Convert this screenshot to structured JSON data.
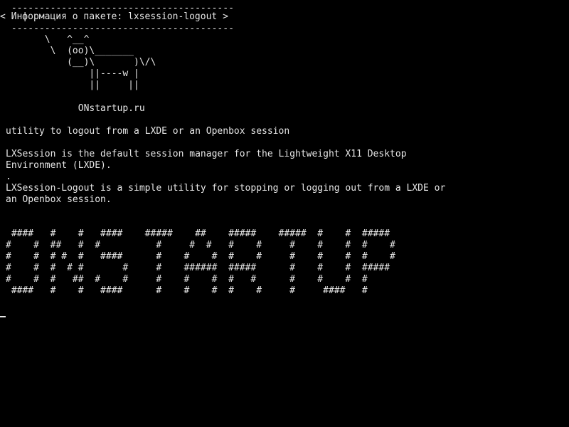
{
  "banner": {
    "top_rule": " ----------------------------------------",
    "title": "< Информация о пакете: lxsession-logout >",
    "bottom_rule": " ----------------------------------------"
  },
  "cow": [
    "       \\   ^__^",
    "        \\  (oo)\\_______",
    "           (__)\\       )\\/\\",
    "               ||----w |",
    "               ||     ||"
  ],
  "site": "             ONstartup.ru",
  "description": {
    "summary": "utility to logout from a LXDE or an Openbox session",
    "p1_line1": "LXSession is the default session manager for the Lightweight X11 Desktop",
    "p1_line2": "Environment (LXDE).",
    "dot": ".",
    "p2_line1": "LXSession-Logout is a simple utility for stopping or logging out from a LXDE or",
    "p2_line2": "an Openbox session."
  },
  "ascii_art": [
    " ####   #    #   ####    #####    ##    #####    #####  #    #  #####",
    "#    #  ##   #  #          #     #  #   #    #     #    #    #  #    #",
    "#    #  # #  #   ####      #    #    #  #    #     #    #    #  #    #",
    "#    #  #  # #       #     #    ######  #####      #    #    #  #####",
    "#    #  #   ##  #    #     #    #    #  #   #      #    #    #  #",
    " ####   #    #   ####      #    #    #  #    #     #     ####   #"
  ]
}
